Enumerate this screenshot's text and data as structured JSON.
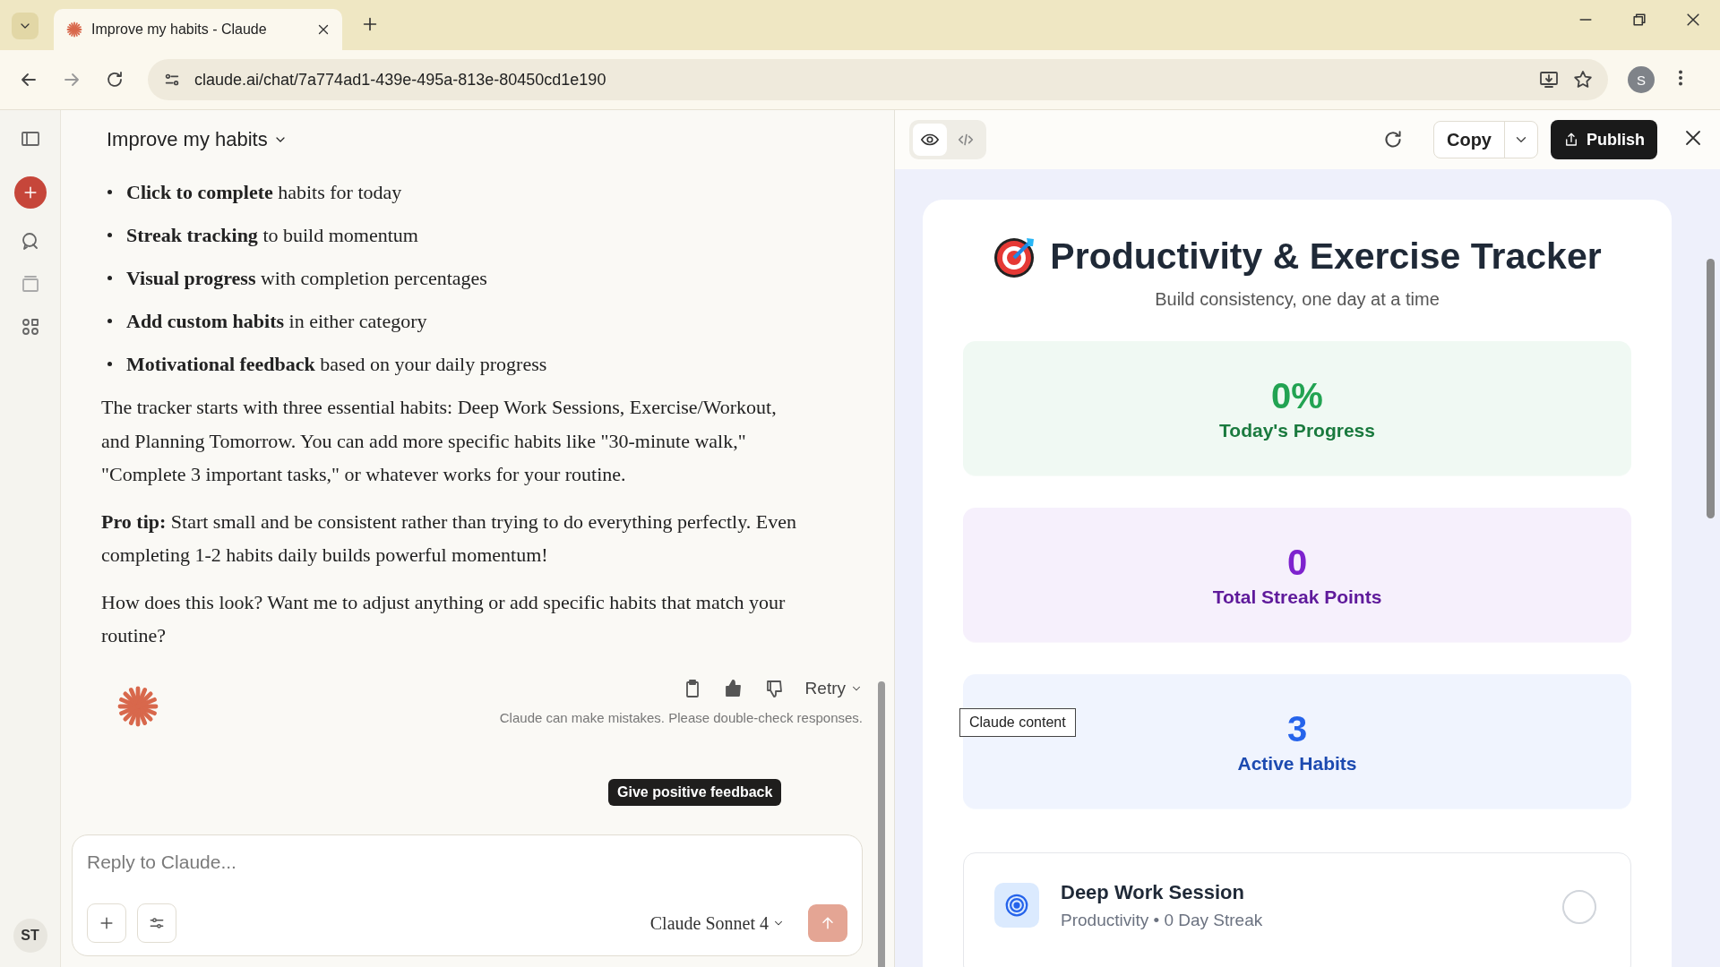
{
  "browser": {
    "tab": {
      "title": "Improve my habits - Claude"
    },
    "url": "claude.ai/chat/7a774ad1-439e-495a-813e-80450cd1e190",
    "profile_initial": "S"
  },
  "sidebar": {
    "user_initials": "ST"
  },
  "chat": {
    "title": "Improve my habits",
    "bullets": [
      "**Click to complete** habits for today",
      "**Streak tracking** to build momentum",
      "**Visual progress** with completion percentages",
      "**Add custom habits** in either category",
      "**Motivational feedback** based on your daily progress"
    ],
    "paragraphs": [
      "The tracker starts with three essential habits: Deep Work Sessions, Exercise/Workout, and Planning Tomorrow. You can add more specific habits like \"30-minute walk,\" \"Complete 3 important tasks,\" or whatever works for your routine.",
      "**Pro tip:** Start small and be consistent rather than trying to do everything perfectly. Even completing 1-2 habits daily builds powerful momentum!",
      "How does this look? Want me to adjust anything or add specific habits that match your routine?"
    ],
    "retry": "Retry",
    "disclaimer": "Claude can make mistakes. Please double-check responses.",
    "tooltip": "Give positive feedback",
    "composer": {
      "placeholder": "Reply to Claude...",
      "model": "Claude Sonnet 4"
    }
  },
  "artifact": {
    "view_tabs": [
      {
        "kind": "preview",
        "selected": true
      },
      {
        "kind": "code",
        "selected": false
      }
    ],
    "copy": "Copy",
    "publish": "Publish",
    "title": "Productivity & Exercise Tracker",
    "subtitle": "Build consistency, one day at a time",
    "stats": [
      {
        "value": "0%",
        "label": "Today's Progress",
        "color": "#22a352"
      },
      {
        "value": "0",
        "label": "Total Streak Points",
        "color": "#7e22ce"
      },
      {
        "value": "3",
        "label": "Active Habits",
        "color": "#2563eb"
      }
    ],
    "habits": [
      {
        "name": "Deep Work Session",
        "meta": "Productivity • 0 Day Streak",
        "checked": false
      }
    ],
    "tooltip": "Claude content"
  }
}
